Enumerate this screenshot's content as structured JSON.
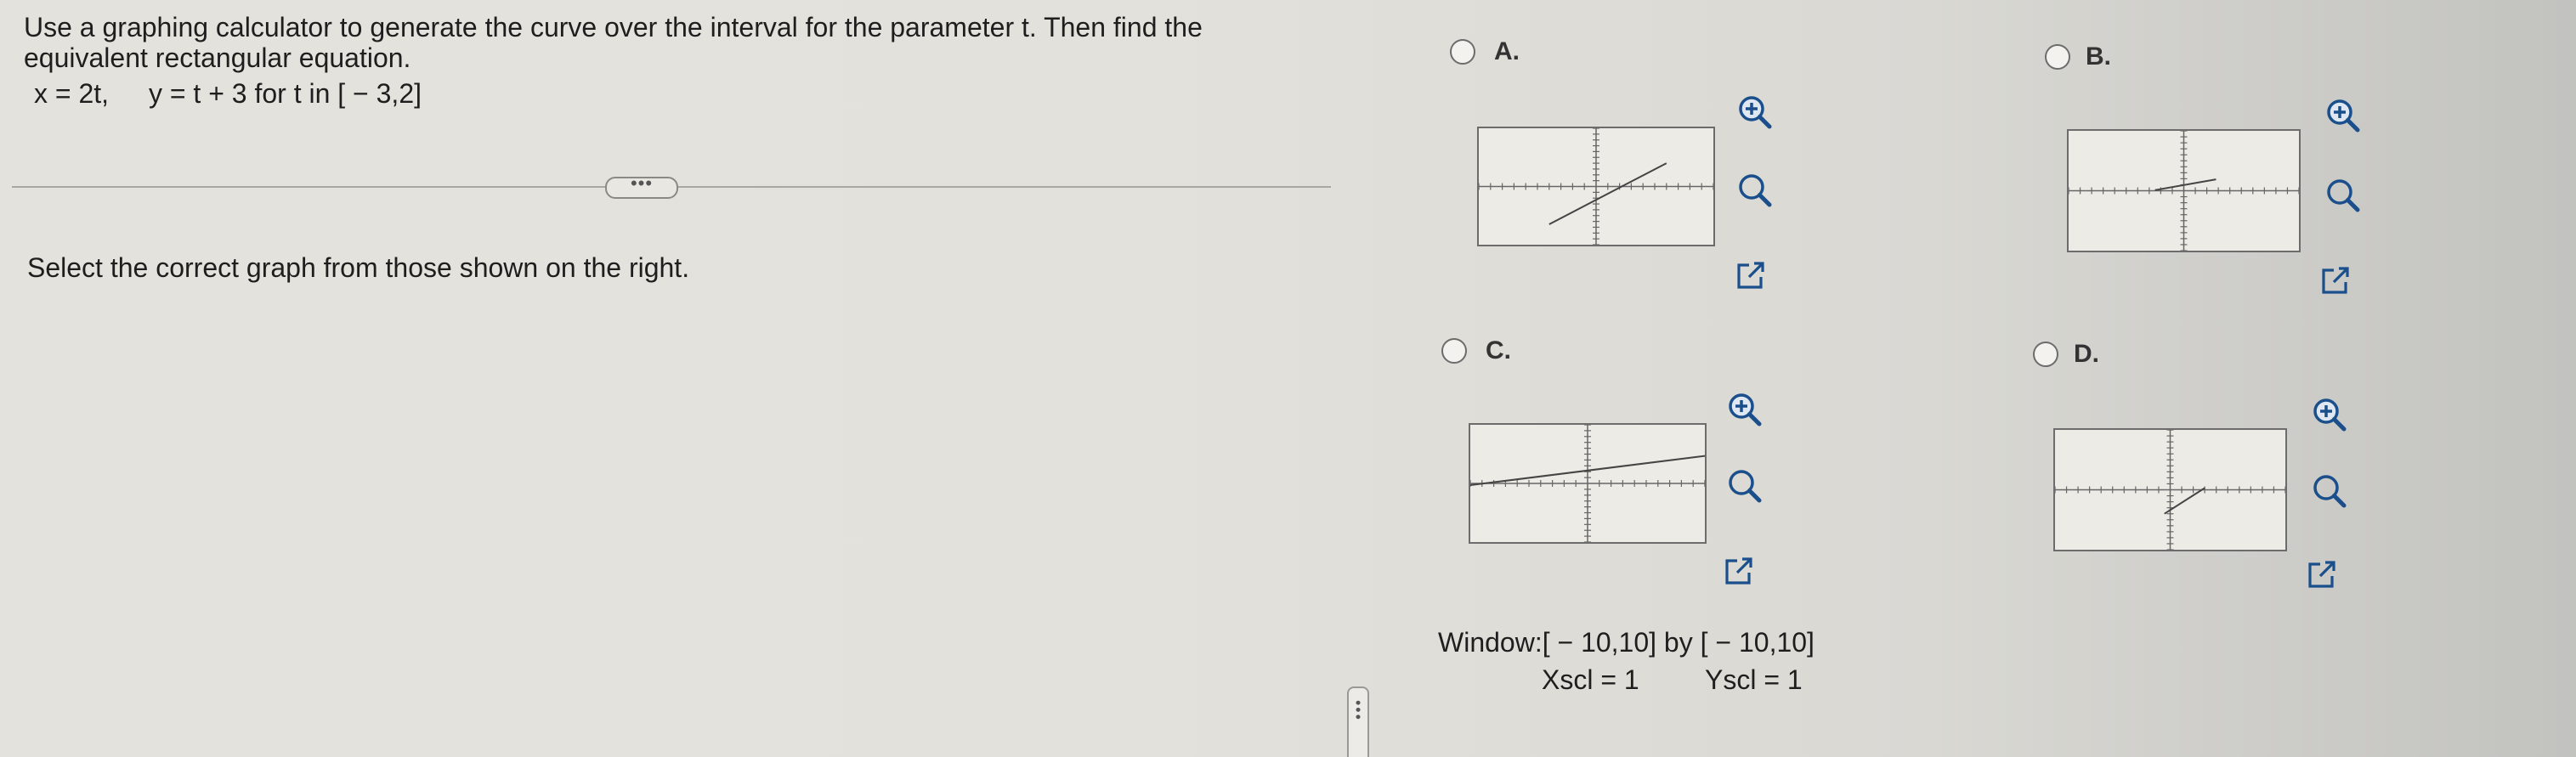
{
  "question": {
    "line1": "Use a graphing calculator to generate the curve over the interval for the parameter t. Then find the",
    "line2": "equivalent rectangular equation.",
    "x_eq": "x = 2t,",
    "y_eq": "y = t + 3 for t in [ − 3,2]"
  },
  "more_button_label": "•••",
  "instruction": "Select the correct graph from those shown on the right.",
  "options": [
    {
      "letter": "A.",
      "segment": [
        -4,
        -6.5,
        6,
        4
      ],
      "segment_desc": "slope 1"
    },
    {
      "letter": "B.",
      "segment": [
        -2.5,
        0.1,
        2.8,
        1.9
      ],
      "segment_desc": "slope 1/3"
    },
    {
      "letter": "C.",
      "segment": [
        -10,
        -0.3,
        10,
        4.7
      ],
      "segment_desc": "slope 1/4"
    },
    {
      "letter": "D.",
      "segment": [
        -0.5,
        -4,
        3,
        0.3
      ],
      "segment_desc": "steep short"
    }
  ],
  "window": {
    "line1": "Window:[ − 10,10] by [ − 10,10]",
    "xscl": "Xscl = 1",
    "yscl": "Yscl = 1"
  },
  "icons": {
    "zoom_in": "zoom-in-icon",
    "zoom_out": "zoom-out-icon",
    "open_new": "open-new-window-icon"
  },
  "colors": {
    "accent": "#1a4f8c",
    "axis": "#666666"
  }
}
